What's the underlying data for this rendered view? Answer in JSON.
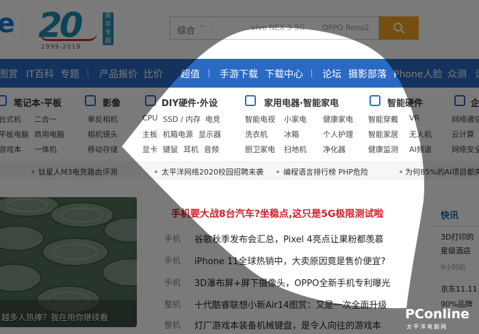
{
  "header": {
    "logo_fragment": "e",
    "anniversary_number": "20",
    "anniversary_years": "1999-2019",
    "anniversary_badge": "周年专题"
  },
  "search": {
    "type_label": "综合",
    "suggestions": [
      "vivo NEX 3 5G",
      "OPPO Reno2"
    ],
    "button_icon": "search-icon"
  },
  "nav": {
    "items": [
      "图赏",
      "IT百科",
      "专题",
      "产品报价",
      "比价",
      "超值",
      "手游下载",
      "下载中心",
      "论坛",
      "摄影部落",
      "Phone人脸",
      "众测",
      "话"
    ]
  },
  "categories": [
    {
      "title": "笔记本·平板",
      "icon": "laptop-icon",
      "links": [
        "台式机",
        "二合一",
        "平板电脑",
        "商用电脑",
        "游戏本",
        "一体机"
      ]
    },
    {
      "title": "影像",
      "icon": "camera-icon",
      "links": [
        "单反相机",
        "相机镜头",
        "移动存储"
      ]
    },
    {
      "title": "DIY硬件·外设",
      "icon": "monitor-icon",
      "links": [
        "CPU",
        "SSD / 内存",
        "电竞",
        "主板",
        "机箱电源",
        "显示器",
        "显卡",
        "键鼠",
        "耳机",
        "音频"
      ]
    },
    {
      "title": "家用电器·智能家电",
      "icon": "appliance-icon",
      "links": [
        "智能电视",
        "小家电",
        "健康家电",
        "洗衣机",
        "冰箱",
        "个人护理",
        "厨卫家电",
        "扫地机",
        "净化器"
      ]
    },
    {
      "title": "智能硬件",
      "icon": "robot-icon",
      "links": [
        "智能穿戴",
        "VR",
        "智能家居",
        "无人机",
        "健康监测",
        "AI频道"
      ]
    },
    {
      "title": "企",
      "icon": "server-icon",
      "links": [
        "网络通信",
        "云计算",
        "网络安全"
      ]
    }
  ],
  "ticker": [
    "钛星人M3电竞路由评测",
    "太平洋网络2020校园招聘来袭",
    "编程语言排行榜 PHP危险",
    "为何85%的AI项目都失败"
  ],
  "hero": {
    "caption": "越多人热捧？我在用你继续看"
  },
  "headline": "手机要大战8台汽车?坐稳点,这只是5G极限测试啦",
  "news": [
    {
      "cat": "手机",
      "title": "谷歌秋季发布会汇总，Pixel 4亮点让果粉都羡慕"
    },
    {
      "cat": "手机",
      "title": "iPhone 11全球热销中，大卖原因竟是售价便宜?"
    },
    {
      "cat": "手机",
      "title": "3D瀑布屏+屏下摄像头，OPPO全新手机专利曝光"
    },
    {
      "cat": "整机",
      "title": "十代酷睿联想小新Air14图赏：又是一次全面升级"
    },
    {
      "cat": "整机",
      "title": "灯厂游戏本装备机械键盘，是令人向往的游戏本"
    }
  ],
  "flash": {
    "title": "快讯",
    "items": [
      {
        "text": "3D打印的",
        "sub": "星级酒店",
        "time": "9小时前"
      },
      {
        "text": "京东11.11",
        "sub": "90%品牌",
        "time": ""
      }
    ]
  },
  "watermark": {
    "brand": "PConline",
    "sub": "太平洋电脑网"
  },
  "colors": {
    "nav_bg": "#2a6ac4",
    "accent_orange": "#f5a623",
    "headline_red": "#d0202a"
  }
}
